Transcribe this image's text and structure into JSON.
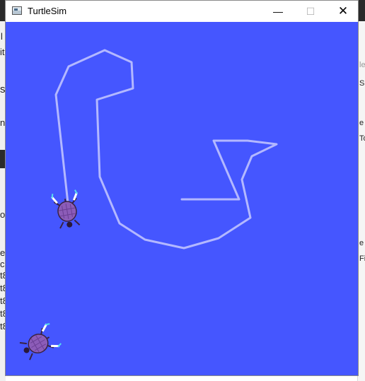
{
  "window": {
    "title": "TurtleSim",
    "minimize_glyph": "—",
    "maximize_glyph": "☐",
    "close_glyph": "✕"
  },
  "canvas": {
    "background_color": "#4556ff",
    "path_color": "#b3b8ff",
    "turtles": [
      {
        "name": "turtle1",
        "icon": "turtle-icon"
      },
      {
        "name": "turtle2",
        "icon": "turtle-icon"
      }
    ]
  },
  "background_fragments": {
    "left": [
      "l",
      "it",
      "s",
      "n",
      "ot",
      "e",
      "cl",
      "t8",
      "t8",
      "t8",
      "t8",
      "t8"
    ],
    "right": [
      "le",
      "S",
      "e",
      "To",
      "e",
      "Fi"
    ]
  }
}
